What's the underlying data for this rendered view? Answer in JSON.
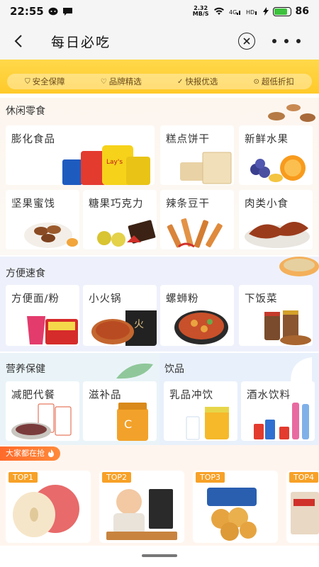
{
  "status": {
    "time": "22:55",
    "speed_top": "2.32",
    "speed_unit": "MB/S",
    "battery": "86"
  },
  "nav": {
    "title": "每日必吃"
  },
  "guarantees": [
    "安全保障",
    "品牌精选",
    "快报优选",
    "超低折扣"
  ],
  "leisure": {
    "title": "休闲零食",
    "items": [
      "膨化食品",
      "糕点饼干",
      "新鲜水果",
      "坚果蜜饯",
      "糖果巧克力",
      "辣条豆干",
      "肉类小食"
    ]
  },
  "fast": {
    "title": "方便速食",
    "items": [
      "方便面/粉",
      "小火锅",
      "螺蛳粉",
      "下饭菜"
    ]
  },
  "health": {
    "title": "营养保健",
    "items": [
      "减肥代餐",
      "滋补品"
    ]
  },
  "drinks": {
    "title": "饮品",
    "items": [
      "乳品冲饮",
      "酒水饮料"
    ]
  },
  "hot": {
    "tag": "大家都在抢",
    "tops": [
      "TOP1",
      "TOP2",
      "TOP3",
      "TOP4"
    ]
  },
  "colors": {
    "banner": "#ffcf33",
    "top_badge": "#f7a127",
    "hot_tag": "#ff6a2a"
  }
}
